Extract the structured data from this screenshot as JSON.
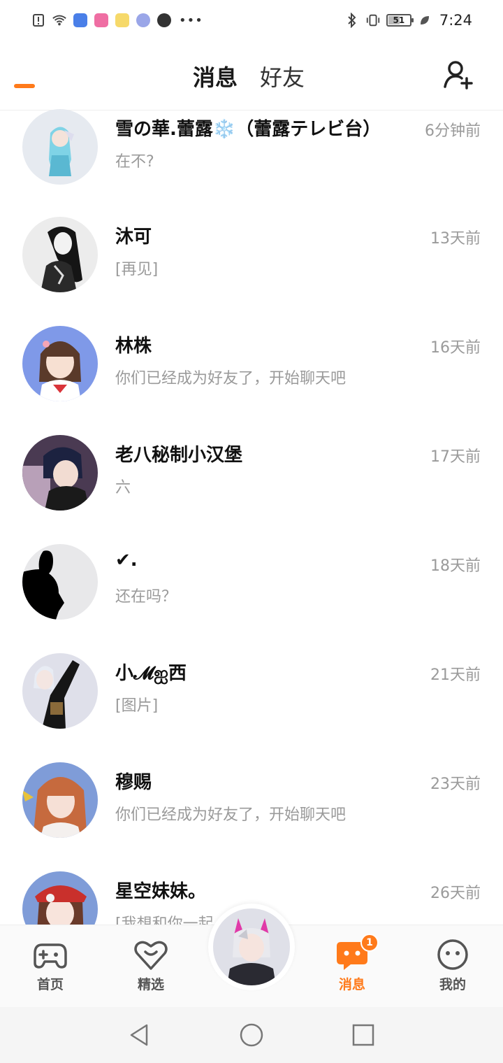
{
  "status_bar": {
    "time": "7:24",
    "battery": "51",
    "battery_level": 0.51
  },
  "header": {
    "tabs": [
      {
        "label": "消息",
        "active": true
      },
      {
        "label": "好友",
        "active": false
      }
    ],
    "add_friend_icon": "add-user-icon",
    "accent_color": "#ff7a1a"
  },
  "messages": [
    {
      "name": "雪の華.蕾露❄️（蕾露テレビ台）",
      "preview": "在不?",
      "time": "6分钟前"
    },
    {
      "name": "沐可",
      "preview": "[再见]",
      "time": "13天前"
    },
    {
      "name": "林株",
      "preview": "你们已经成为好友了，开始聊天吧",
      "time": "16天前"
    },
    {
      "name": "老八秘制小汉堡",
      "preview": "六",
      "time": "17天前"
    },
    {
      "name": "✔.",
      "preview": "还在吗？",
      "time": "18天前"
    },
    {
      "name": "小𝓜ஐ西",
      "preview": "[图片]",
      "time": "21天前"
    },
    {
      "name": "穆赐",
      "preview": "你们已经成为好友了，开始聊天吧",
      "time": "23天前"
    },
    {
      "name": "星空妹妹。",
      "preview": "[我想和你一起…照]",
      "time": "26天前"
    }
  ],
  "bottom_nav": {
    "items": [
      {
        "label": "首页",
        "icon": "gamepad-icon"
      },
      {
        "label": "精选",
        "icon": "heart-smile-icon"
      },
      {
        "label": "消息",
        "icon": "chat-bubble-icon",
        "badge": "1",
        "active": true
      },
      {
        "label": "我的",
        "icon": "face-icon"
      }
    ]
  }
}
